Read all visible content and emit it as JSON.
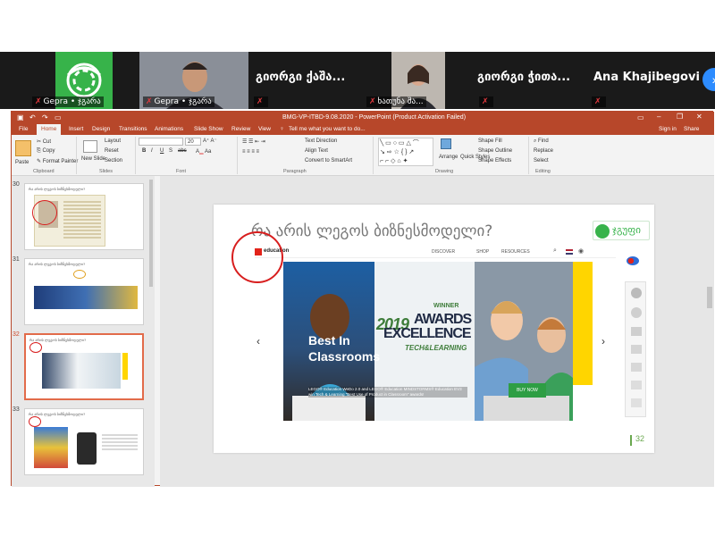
{
  "participants": [
    {
      "name": "",
      "label": "Gepra • ჯგარა"
    },
    {
      "name": "",
      "label": "Gepra • ჯგარა"
    },
    {
      "name": "გიორგი ქაშა...",
      "label": ""
    },
    {
      "name": "",
      "label": "ხათუნა შა..."
    },
    {
      "name": "გიორგი ჭითა...",
      "label": ""
    },
    {
      "name": "Ana Khajibegovi",
      "label": ""
    }
  ],
  "window": {
    "title": "BMG-VP-ITBD-9.08.2020 - PowerPoint (Product Activation Failed)",
    "sign_in": "Sign in",
    "share": "Share"
  },
  "ribbon_tabs": [
    "File",
    "Home",
    "Insert",
    "Design",
    "Transitions",
    "Animations",
    "Slide Show",
    "Review",
    "View"
  ],
  "tell_me": "Tell me what you want to do...",
  "ribbon": {
    "paste": "Paste",
    "cut": "Cut",
    "copy": "Copy",
    "format_painter": "Format Painter",
    "clipboard": "Clipboard",
    "new_slide": "New Slide",
    "layout": "Layout",
    "reset": "Reset",
    "section": "Section",
    "slides": "Slides",
    "font_size": "20",
    "font": "Font",
    "text_direction": "Text Direction",
    "align_text": "Align Text",
    "convert_smartart": "Convert to SmartArt",
    "paragraph": "Paragraph",
    "arrange": "Arrange",
    "quick_styles": "Quick Styles",
    "shape_fill": "Shape Fill",
    "shape_outline": "Shape Outline",
    "shape_effects": "Shape Effects",
    "drawing": "Drawing",
    "find": "Find",
    "replace": "Replace",
    "select": "Select",
    "editing": "Editing",
    "bold": "B",
    "italic": "I",
    "underline": "U",
    "strike": "S",
    "abc": "abc"
  },
  "thumbnails": [
    {
      "number": "30",
      "title": "რა არის ლეგოს ბიზნესმოდელი?"
    },
    {
      "number": "31",
      "title": "რა არის ლეგოს ბიზნესმოდელი?"
    },
    {
      "number": "32",
      "title": "რა არის ლეგოს ბიზნესმოდელი?"
    },
    {
      "number": "33",
      "title": "რა არის ლეგოს ბიზნესმოდელი?"
    }
  ],
  "slide": {
    "title": "რა არის ლეგოს ბიზნესმოდელი?",
    "number": "32",
    "logo_text": "ჯგუფი",
    "site": {
      "brand": "education",
      "nav": [
        "DISCOVER",
        "SHOP",
        "RESOURCES"
      ],
      "hero_title_1": "Best In",
      "hero_title_2": "Classrooms",
      "hero_desc": "LEGO® Education WeDo 2.0 and LEGO® Education MINDSTORMS® Education EV3 win Tech & Learning \"Best Use of Product in Classroom\" awards!",
      "award_year": "2019",
      "award_line1": "AWARDS",
      "award_line2": "EXCELLENCE",
      "award_winner": "WINNER",
      "award_sub": "TECH&LEARNING",
      "buy_button": "BUY NOW"
    }
  },
  "colors": {
    "ppt_accent": "#b7472a",
    "zoom_muted": "#e0393e",
    "annotation": "#d81e1e",
    "lego_yellow": "#ffd500",
    "buy_green": "#2e9e44"
  }
}
